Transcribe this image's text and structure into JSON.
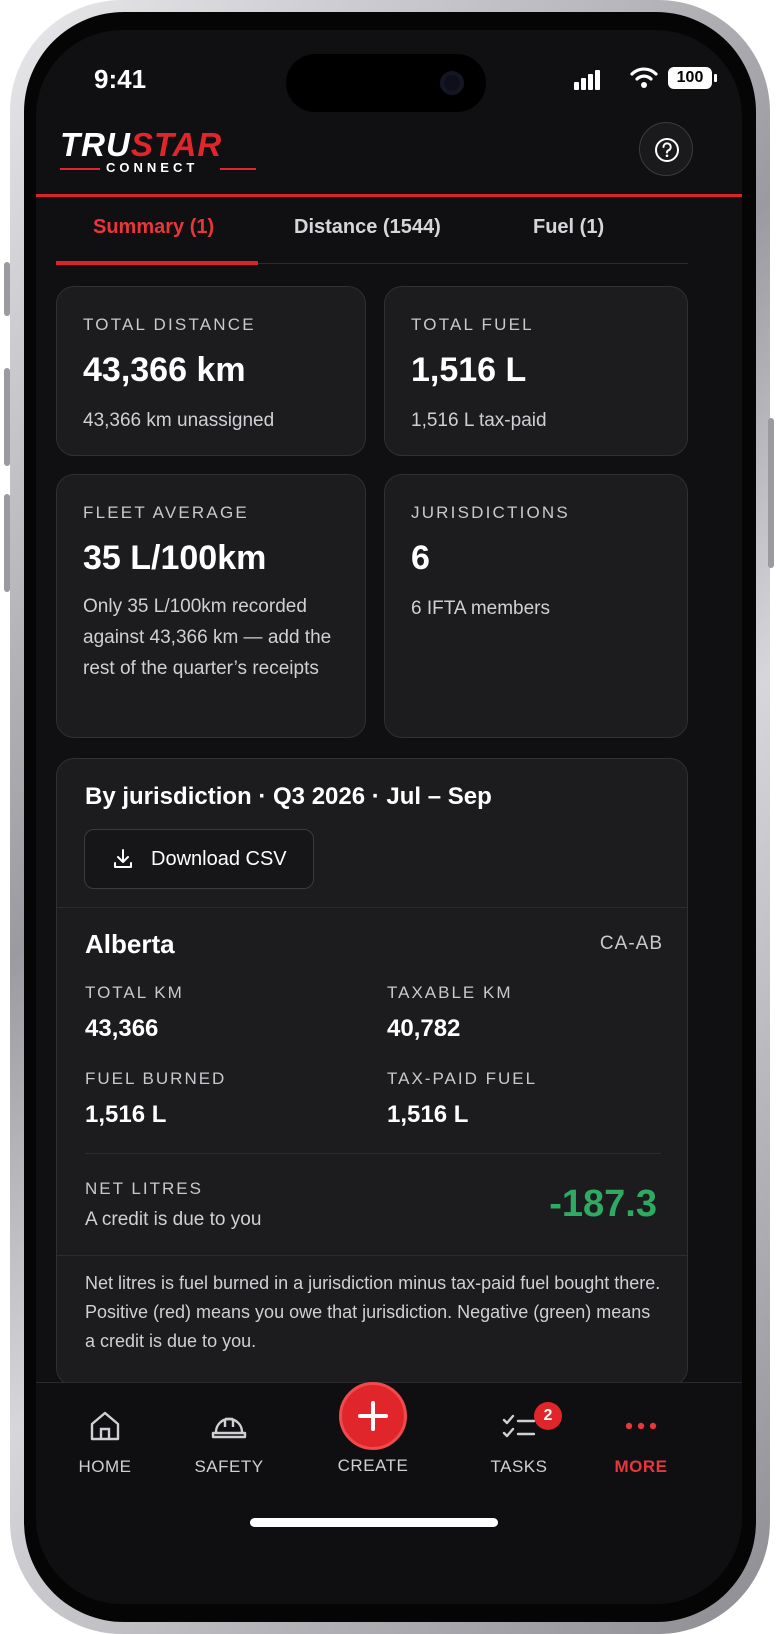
{
  "status_bar": {
    "time": "9:41",
    "battery": "100"
  },
  "brand": {
    "logo_main": "TRUSTAR",
    "logo_main_red": "STAR",
    "logo_sub": "CONNECT"
  },
  "tabs": [
    {
      "label": "Summary (1)",
      "active": true
    },
    {
      "label": "Distance (1544)",
      "active": false
    },
    {
      "label": "Fuel (1)",
      "active": false
    }
  ],
  "cards": {
    "total_distance": {
      "label": "TOTAL DISTANCE",
      "value": "43,366 km",
      "sub": "43,366 km unassigned"
    },
    "total_fuel": {
      "label": "TOTAL FUEL",
      "value": "1,516 L",
      "sub": "1,516 L tax-paid"
    },
    "fleet_average": {
      "label": "FLEET AVERAGE",
      "value": "35 L/100km",
      "sub": "Only 35 L/100km recorded against 43,366 km — add the rest of the quarter’s receipts"
    },
    "jurisdictions": {
      "label": "JURISDICTIONS",
      "value": "6",
      "sub": "6 IFTA members"
    }
  },
  "jurisdiction_section": {
    "title": "By jurisdiction · Q3 2026 · Jul – Sep",
    "download_label": "Download CSV",
    "region": "Alberta",
    "region_code": "CA-AB",
    "total_km_label": "TOTAL KM",
    "total_km": "43,366",
    "taxable_km_label": "TAXABLE KM",
    "taxable_km": "40,782",
    "fuel_burned_label": "FUEL BURNED",
    "fuel_burned": "1,516 L",
    "tax_paid_fuel_label": "TAX-PAID FUEL",
    "tax_paid_fuel": "1,516 L",
    "net_litres_label": "NET LITRES",
    "net_litres_sub": "A credit is due to you",
    "net_litres_value": "-187.3",
    "footnote": "Net litres is fuel burned in a jurisdiction minus tax-paid fuel bought there. Positive (red) means you owe that jurisdiction. Negative (green) means a credit is due to you."
  },
  "bottom_nav": {
    "home": "HOME",
    "safety": "SAFETY",
    "create": "CREATE",
    "tasks": "TASKS",
    "tasks_badge": "2",
    "more": "MORE"
  },
  "colors": {
    "accent": "#e0262a",
    "credit": "#2eaa62",
    "background": "#101012",
    "card": "#1c1c1f"
  }
}
